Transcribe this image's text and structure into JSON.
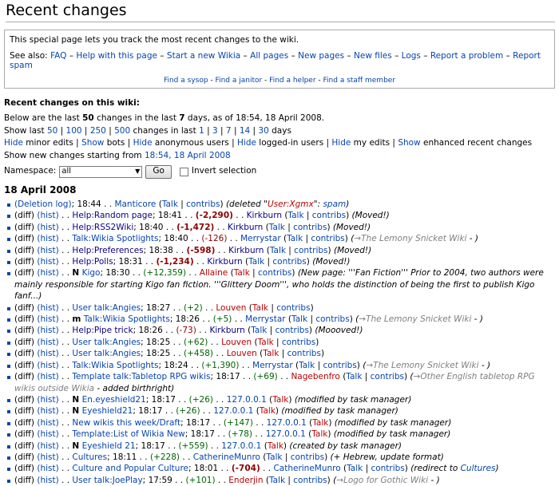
{
  "header": {
    "title": "Recent changes"
  },
  "intro": {
    "text": "This special page lets you track the most recent changes to the wiki.",
    "see_also_label": "See also:",
    "see_also_links": [
      "FAQ",
      "Help with this page",
      "Start a new Wikia",
      "All pages",
      "New pages",
      "New files",
      "Logs",
      "Report a problem",
      "Report spam"
    ],
    "find_links": [
      "Find a sysop",
      "Find a janitor",
      "Find a helper",
      "Find a staff member"
    ]
  },
  "options": {
    "section_title": "Recent changes on this wiki:",
    "below_prefix": "Below are the last ",
    "below_count": "50",
    "below_mid": " changes in the last ",
    "below_days": "7",
    "below_suffix": " days, as of 18:54, 18 April 2008.",
    "show_last_label": "Show last ",
    "show_last_counts": [
      "50",
      "100",
      "250",
      "500"
    ],
    "changes_in_last": " changes in last ",
    "show_last_days": [
      "1",
      "3",
      "7",
      "14",
      "30"
    ],
    "days_label": " days",
    "hide_line": [
      {
        "action": "Hide",
        "label": " minor edits"
      },
      {
        "action": "Show",
        "label": " bots"
      },
      {
        "action": "Hide",
        "label": " anonymous users"
      },
      {
        "action": "Hide",
        "label": " logged-in users"
      },
      {
        "action": "Hide",
        "label": " my edits"
      },
      {
        "action": "Show",
        "label": " enhanced recent changes"
      }
    ],
    "new_changes_prefix": "Show new changes starting from ",
    "new_changes_link": "18:54, 18 April 2008",
    "namespace_label": "Namespace:",
    "namespace_value": "all",
    "go_label": "Go",
    "invert_label": "Invert selection"
  },
  "day_heading": "18 April 2008",
  "changes": [
    {
      "diff": "(Deletion log)",
      "hist": "",
      "flag": "",
      "page": "",
      "page_cls": "",
      "time": "18:44",
      "size": "",
      "size_cls": "",
      "user": "Manticore",
      "user_cls": "",
      "talk": "Talk",
      "talk_cls": "",
      "contribs": "contribs",
      "comment_pre": "(deleted \"",
      "comment_link": "User:Xgmx",
      "comment_link_cls": "new",
      "comment_post": "\": ",
      "comment_tail_link": "spam",
      "comment_tail": ")"
    },
    {
      "diff": "(diff)",
      "hist": "(hist)",
      "flag": "",
      "page": "Help:Random page",
      "page_cls": "visited",
      "time": "18:41",
      "size": "(-2,290)",
      "size_cls": "bigneg",
      "user": "Kirkburn",
      "user_cls": "visited",
      "talk": "Talk",
      "talk_cls": "",
      "contribs": "contribs",
      "comment_pre": "(Moved!)",
      "comment_link": "",
      "comment_link_cls": "",
      "comment_post": "",
      "comment_tail_link": "",
      "comment_tail": ""
    },
    {
      "diff": "(diff)",
      "hist": "(hist)",
      "flag": "",
      "page": "Help:RSS2Wiki",
      "page_cls": "visited",
      "time": "18:40",
      "size": "(-1,472)",
      "size_cls": "bigneg",
      "user": "Kirkburn",
      "user_cls": "visited",
      "talk": "Talk",
      "talk_cls": "",
      "contribs": "contribs",
      "comment_pre": "(Moved!)",
      "comment_link": "",
      "comment_link_cls": "",
      "comment_post": "",
      "comment_tail_link": "",
      "comment_tail": ""
    },
    {
      "diff": "(diff)",
      "hist": "(hist)",
      "flag": "",
      "page": "Talk:Wikia Spotlights",
      "page_cls": "",
      "time": "18:40",
      "size": "(-126)",
      "size_cls": "neg",
      "user": "Merrystar",
      "user_cls": "",
      "talk": "Talk",
      "talk_cls": "",
      "contribs": "contribs",
      "comment_pre": "(",
      "comment_link": "→The Lemony Snicket Wiki",
      "comment_link_cls": "gray",
      "comment_post": " - )",
      "comment_tail_link": "",
      "comment_tail": ""
    },
    {
      "diff": "(diff)",
      "hist": "(hist)",
      "flag": "",
      "page": "Help:Preferences",
      "page_cls": "visited",
      "time": "18:38",
      "size": "(-598)",
      "size_cls": "bigneg",
      "user": "Kirkburn",
      "user_cls": "visited",
      "talk": "Talk",
      "talk_cls": "",
      "contribs": "contribs",
      "comment_pre": "(Moved!)",
      "comment_link": "",
      "comment_link_cls": "",
      "comment_post": "",
      "comment_tail_link": "",
      "comment_tail": ""
    },
    {
      "diff": "(diff)",
      "hist": "(hist)",
      "flag": "",
      "page": "Help:Polls",
      "page_cls": "visited",
      "time": "18:31",
      "size": "(-1,234)",
      "size_cls": "bigneg",
      "user": "Kirkburn",
      "user_cls": "visited",
      "talk": "Talk",
      "talk_cls": "",
      "contribs": "contribs",
      "comment_pre": "(Moved!)",
      "comment_link": "",
      "comment_link_cls": "",
      "comment_post": "",
      "comment_tail_link": "",
      "comment_tail": ""
    },
    {
      "diff": "(diff)",
      "hist": "(hist)",
      "flag": "N",
      "page": "Kigo",
      "page_cls": "",
      "time": "18:30",
      "size": "(+12,359)",
      "size_cls": "pos",
      "user": "Allaine",
      "user_cls": "new",
      "talk": "Talk",
      "talk_cls": "new",
      "contribs": "contribs",
      "comment_pre": "(New page: '''Fan Fiction''' Prior to 2004, two authors were mainly responsible for starting Kigo fan fiction. '''Glittery Doom''', who holds the distinction of being the first to publish Kigo fanf...)",
      "comment_link": "",
      "comment_link_cls": "",
      "comment_post": "",
      "comment_tail_link": "",
      "comment_tail": ""
    },
    {
      "diff": "(diff)",
      "hist": "(hist)",
      "flag": "",
      "page": "User talk:Angies",
      "page_cls": "",
      "time": "18:27",
      "size": "(+2)",
      "size_cls": "pos",
      "user": "Louven",
      "user_cls": "new",
      "talk": "Talk",
      "talk_cls": "new",
      "contribs": "contribs",
      "comment_pre": "",
      "comment_link": "",
      "comment_link_cls": "",
      "comment_post": "",
      "comment_tail_link": "",
      "comment_tail": ""
    },
    {
      "diff": "(diff)",
      "hist": "(hist)",
      "flag": "m",
      "page": "Talk:Wikia Spotlights",
      "page_cls": "",
      "time": "18:26",
      "size": "(+5)",
      "size_cls": "pos",
      "user": "Merrystar",
      "user_cls": "",
      "talk": "Talk",
      "talk_cls": "",
      "contribs": "contribs",
      "comment_pre": "(",
      "comment_link": "→The Lemony Snicket Wiki",
      "comment_link_cls": "gray",
      "comment_post": " - )",
      "comment_tail_link": "",
      "comment_tail": ""
    },
    {
      "diff": "(diff)",
      "hist": "(hist)",
      "flag": "",
      "page": "Help:Pipe trick",
      "page_cls": "visited",
      "time": "18:26",
      "size": "(-73)",
      "size_cls": "neg",
      "user": "Kirkburn",
      "user_cls": "visited",
      "talk": "Talk",
      "talk_cls": "",
      "contribs": "contribs",
      "comment_pre": "(Moooved!)",
      "comment_link": "",
      "comment_link_cls": "",
      "comment_post": "",
      "comment_tail_link": "",
      "comment_tail": ""
    },
    {
      "diff": "(diff)",
      "hist": "(hist)",
      "flag": "",
      "page": "User talk:Angies",
      "page_cls": "",
      "time": "18:25",
      "size": "(+62)",
      "size_cls": "pos",
      "user": "Louven",
      "user_cls": "new",
      "talk": "Talk",
      "talk_cls": "new",
      "contribs": "contribs",
      "comment_pre": "",
      "comment_link": "",
      "comment_link_cls": "",
      "comment_post": "",
      "comment_tail_link": "",
      "comment_tail": ""
    },
    {
      "diff": "(diff)",
      "hist": "(hist)",
      "flag": "",
      "page": "User talk:Angies",
      "page_cls": "",
      "time": "18:25",
      "size": "(+458)",
      "size_cls": "pos",
      "user": "Louven",
      "user_cls": "new",
      "talk": "Talk",
      "talk_cls": "new",
      "contribs": "contribs",
      "comment_pre": "",
      "comment_link": "",
      "comment_link_cls": "",
      "comment_post": "",
      "comment_tail_link": "",
      "comment_tail": ""
    },
    {
      "diff": "(diff)",
      "hist": "(hist)",
      "flag": "",
      "page": "Talk:Wikia Spotlights",
      "page_cls": "",
      "time": "18:24",
      "size": "(+1,390)",
      "size_cls": "pos",
      "user": "Merrystar",
      "user_cls": "",
      "talk": "Talk",
      "talk_cls": "",
      "contribs": "contribs",
      "comment_pre": "(",
      "comment_link": "→The Lemony Snicket Wiki",
      "comment_link_cls": "gray",
      "comment_post": " - )",
      "comment_tail_link": "",
      "comment_tail": ""
    },
    {
      "diff": "(diff)",
      "hist": "(hist)",
      "flag": "",
      "page": "Template talk:Tabletop RPG wikis",
      "page_cls": "",
      "time": "18:17",
      "size": "(+69)",
      "size_cls": "pos",
      "user": "Nagebenfro",
      "user_cls": "new",
      "talk": "Talk",
      "talk_cls": "",
      "contribs": "contribs",
      "comment_pre": "(",
      "comment_link": "→Other English tabletop RPG wikis outside Wikia",
      "comment_link_cls": "gray",
      "comment_post": " - added birthright)",
      "comment_tail_link": "",
      "comment_tail": ""
    },
    {
      "diff": "(diff)",
      "hist": "(hist)",
      "flag": "N",
      "page": "En.eyeshield21",
      "page_cls": "",
      "time": "18:17",
      "size": "(+26)",
      "size_cls": "pos",
      "user": "127.0.0.1",
      "user_cls": "",
      "talk": "Talk",
      "talk_cls": "new",
      "contribs": "",
      "comment_pre": "(modified by task manager)",
      "comment_link": "",
      "comment_link_cls": "",
      "comment_post": "",
      "comment_tail_link": "",
      "comment_tail": ""
    },
    {
      "diff": "(diff)",
      "hist": "(hist)",
      "flag": "N",
      "page": "Eyeshield21",
      "page_cls": "",
      "time": "18:17",
      "size": "(+26)",
      "size_cls": "pos",
      "user": "127.0.0.1",
      "user_cls": "",
      "talk": "Talk",
      "talk_cls": "new",
      "contribs": "",
      "comment_pre": "(modified by task manager)",
      "comment_link": "",
      "comment_link_cls": "",
      "comment_post": "",
      "comment_tail_link": "",
      "comment_tail": ""
    },
    {
      "diff": "(diff)",
      "hist": "(hist)",
      "flag": "",
      "page": "New wikis this week/Draft",
      "page_cls": "",
      "time": "18:17",
      "size": "(+147)",
      "size_cls": "pos",
      "user": "127.0.0.1",
      "user_cls": "",
      "talk": "Talk",
      "talk_cls": "new",
      "contribs": "",
      "comment_pre": "(modified by task manager)",
      "comment_link": "",
      "comment_link_cls": "",
      "comment_post": "",
      "comment_tail_link": "",
      "comment_tail": ""
    },
    {
      "diff": "(diff)",
      "hist": "(hist)",
      "flag": "",
      "page": "Template:List of Wikia New",
      "page_cls": "",
      "time": "18:17",
      "size": "(+78)",
      "size_cls": "pos",
      "user": "127.0.0.1",
      "user_cls": "",
      "talk": "Talk",
      "talk_cls": "new",
      "contribs": "",
      "comment_pre": "(modified by task manager)",
      "comment_link": "",
      "comment_link_cls": "",
      "comment_post": "",
      "comment_tail_link": "",
      "comment_tail": ""
    },
    {
      "diff": "(diff)",
      "hist": "(hist)",
      "flag": "N",
      "page": "Eyeshield 21",
      "page_cls": "",
      "time": "18:17",
      "size": "(+559)",
      "size_cls": "pos",
      "user": "127.0.0.1",
      "user_cls": "",
      "talk": "Talk",
      "talk_cls": "new",
      "contribs": "",
      "comment_pre": "(created by task manager)",
      "comment_link": "",
      "comment_link_cls": "",
      "comment_post": "",
      "comment_tail_link": "",
      "comment_tail": ""
    },
    {
      "diff": "(diff)",
      "hist": "(hist)",
      "flag": "",
      "page": "Cultures",
      "page_cls": "",
      "time": "18:11",
      "size": "(+228)",
      "size_cls": "pos",
      "user": "CatherineMunro",
      "user_cls": "",
      "talk": "Talk",
      "talk_cls": "",
      "contribs": "contribs",
      "comment_pre": "(+ Hebrew, update format)",
      "comment_link": "",
      "comment_link_cls": "",
      "comment_post": "",
      "comment_tail_link": "",
      "comment_tail": ""
    },
    {
      "diff": "(diff)",
      "hist": "(hist)",
      "flag": "",
      "page": "Culture and Popular Culture",
      "page_cls": "",
      "time": "18:01",
      "size": "(-704)",
      "size_cls": "bigneg",
      "user": "CatherineMunro",
      "user_cls": "",
      "talk": "Talk",
      "talk_cls": "",
      "contribs": "contribs",
      "comment_pre": "(redirect to ",
      "comment_link": "Cultures",
      "comment_link_cls": "",
      "comment_post": ")",
      "comment_tail_link": "",
      "comment_tail": ""
    },
    {
      "diff": "(diff)",
      "hist": "(hist)",
      "flag": "",
      "page": "User talk:JoePlay",
      "page_cls": "",
      "time": "17:59",
      "size": "(+101)",
      "size_cls": "pos",
      "user": "Enderjin",
      "user_cls": "new",
      "talk": "Talk",
      "talk_cls": "",
      "contribs": "contribs",
      "comment_pre": "(",
      "comment_link": "→Logo for Gothic Wiki",
      "comment_link_cls": "gray",
      "comment_post": " - )",
      "comment_tail_link": "",
      "comment_tail": ""
    }
  ]
}
